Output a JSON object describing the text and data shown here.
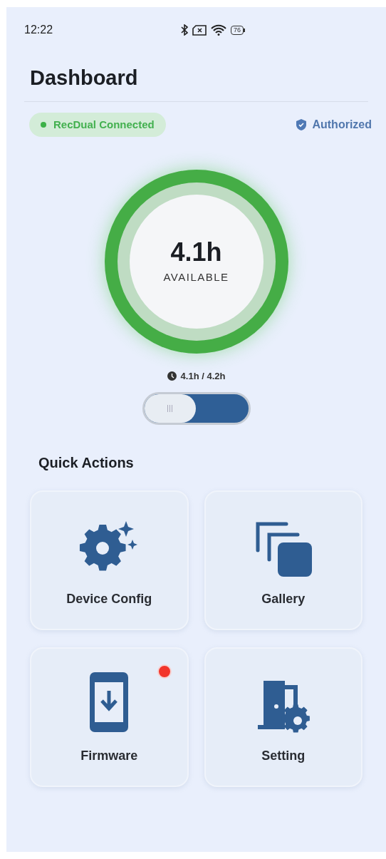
{
  "status_bar": {
    "time": "12:22",
    "battery": "76"
  },
  "title": "Dashboard",
  "connection": {
    "label": "RecDual Connected",
    "connected": true
  },
  "authorization": {
    "label": "Authorized",
    "authorized": true
  },
  "gauge": {
    "value": "4.1h",
    "caption": "AVAILABLE"
  },
  "usage": {
    "text": "4.1h / 4.2h"
  },
  "mode_switch": {
    "on": true
  },
  "quick_actions": {
    "title": "Quick Actions",
    "items": [
      {
        "kind": "config",
        "label": "Device Config",
        "badge": false
      },
      {
        "kind": "gallery",
        "label": "Gallery",
        "badge": false
      },
      {
        "kind": "firmware",
        "label": "Firmware",
        "badge": true
      },
      {
        "kind": "setting",
        "label": "Setting",
        "badge": false
      }
    ]
  }
}
